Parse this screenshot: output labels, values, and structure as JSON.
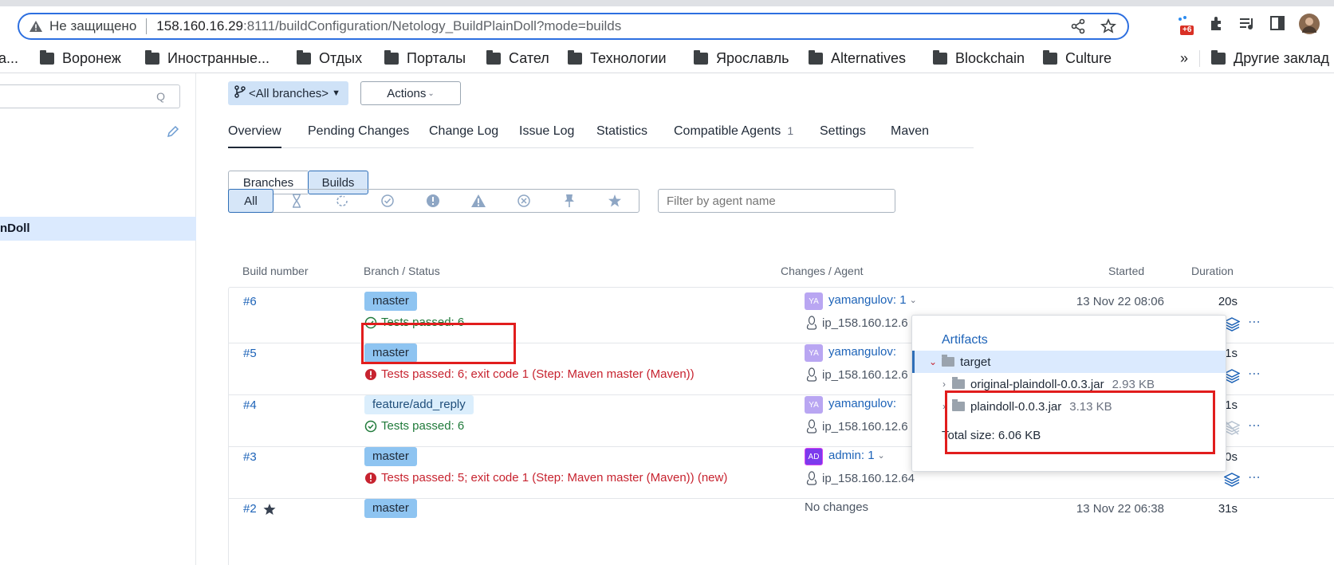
{
  "browser": {
    "security_label": "Не защищено",
    "url_host": "158.160.16.29",
    "url_rest": ":8111/buildConfiguration/Netology_BuildPlainDoll?mode=builds",
    "extension_badge": "+6",
    "bookmarks": [
      "а...",
      "Воронеж",
      "Иностранные...",
      "Отдых",
      "Порталы",
      "Сател",
      "Технологии",
      "Ярославль",
      "Alternatives",
      "Blockchain",
      "Culture"
    ],
    "bookmarks_overflow": "»",
    "other_bookmarks": "Другие заклад"
  },
  "sidebar": {
    "search_icon_text": "Q",
    "selected_item": "nDoll"
  },
  "toolbar": {
    "branches_label": "<All branches>",
    "actions_label": "Actions"
  },
  "tabs": [
    {
      "label": "Overview",
      "active": true
    },
    {
      "label": "Pending Changes"
    },
    {
      "label": "Change Log"
    },
    {
      "label": "Issue Log"
    },
    {
      "label": "Statistics"
    },
    {
      "label": "Compatible Agents",
      "count": "1"
    },
    {
      "label": "Settings"
    },
    {
      "label": "Maven"
    }
  ],
  "view_toggle": {
    "branches": "Branches",
    "builds": "Builds",
    "selected": "Builds"
  },
  "filters": {
    "all_label": "All",
    "icons": [
      "hourglass-icon",
      "running-icon",
      "success-icon",
      "failed-icon",
      "warning-icon",
      "cancelled-icon",
      "pin-icon",
      "star-icon"
    ],
    "agent_placeholder": "Filter by agent name"
  },
  "table": {
    "headers": {
      "build_number": "Build number",
      "branch_status": "Branch / Status",
      "changes_agent": "Changes / Agent",
      "started": "Started",
      "duration": "Duration"
    },
    "rows": [
      {
        "number": "#6",
        "branch": "master",
        "status": "Tests passed: 6",
        "status_type": "ok",
        "avatar": "YA",
        "user": "yamangulov: 1",
        "agent": "ip_158.160.12.6",
        "started": "13 Nov 22 08:06",
        "duration": "20s"
      },
      {
        "number": "#5",
        "branch": "master",
        "status": "Tests passed: 6; exit code 1 (Step: Maven master (Maven))",
        "status_type": "fail",
        "avatar": "YA",
        "user": "yamangulov:",
        "agent": "ip_158.160.12.6",
        "started": "",
        "duration": "21s"
      },
      {
        "number": "#4",
        "branch": "feature/add_reply",
        "status": "Tests passed: 6",
        "status_type": "ok",
        "avatar": "YA",
        "user": "yamangulov:",
        "agent": "ip_158.160.12.6",
        "started": "",
        "duration": "21s"
      },
      {
        "number": "#3",
        "branch": "master",
        "status": "Tests passed: 5; exit code 1 (Step: Maven master (Maven)) (new)",
        "status_type": "fail",
        "avatar": "AD",
        "user": "admin: 1",
        "agent": "ip_158.160.12.64",
        "started": "",
        "duration": "20s"
      },
      {
        "number": "#2",
        "branch": "master",
        "status": "",
        "status_type": "ok",
        "avatar": "",
        "user": "",
        "no_changes": "No changes",
        "agent": "",
        "started": "13 Nov 22 06:38",
        "duration": "31s"
      }
    ]
  },
  "artifacts_popup": {
    "title": "Artifacts",
    "folder": "target",
    "files": [
      {
        "name": "original-plaindoll-0.0.3.jar",
        "size": "2.93 KB"
      },
      {
        "name": "plaindoll-0.0.3.jar",
        "size": "3.13 KB"
      }
    ],
    "total": "Total size: 6.06 KB"
  },
  "colors": {
    "accent_blue": "#1d63b8",
    "success_green": "#1f7a3a",
    "error_red": "#c7232f",
    "annotation_red": "#e11d1d",
    "branch_badge": "#8ec4f1"
  }
}
